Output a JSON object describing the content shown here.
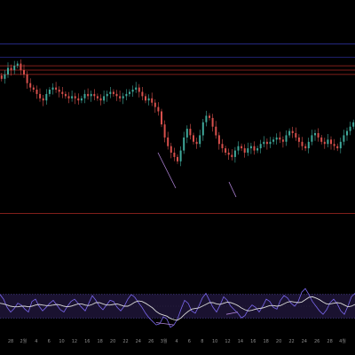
{
  "colors": {
    "background": "#000000",
    "candle_up": "#3fa89a",
    "candle_down": "#d8504c",
    "upper_level": "#3a3fc8",
    "lower_level": "#c8302a",
    "rsi_line": "#7b68ee",
    "rsi_signal": "#d9d9d9",
    "rsi_band_fill": "#1a1230",
    "rsi_band_border": "#6a5acd",
    "axis_text": "#8c8c8c",
    "divergence": "#b084d8"
  },
  "chart_data": [
    {
      "type": "candlestick",
      "title": "",
      "xlabel": "",
      "ylabel": "",
      "x_tick_labels": [
        "28",
        "2월",
        "4",
        "6",
        "10",
        "12",
        "16",
        "18",
        "20",
        "22",
        "24",
        "26",
        "3월",
        "4",
        "6",
        "8",
        "10",
        "12",
        "14",
        "16",
        "18",
        "20",
        "22",
        "24",
        "26",
        "28",
        "4월"
      ],
      "horizontal_levels": [
        {
          "name": "level-1",
          "value": 100,
          "color": "#3a3fc8"
        },
        {
          "name": "level-2",
          "value": 94,
          "color": "#3a3fc8"
        },
        {
          "name": "level-3",
          "value": 90,
          "color": "#c8302a"
        },
        {
          "name": "level-4",
          "value": 88,
          "color": "#c8302a"
        },
        {
          "name": "level-5",
          "value": 86,
          "color": "#c8302a"
        },
        {
          "name": "level-6",
          "value": 22,
          "color": "#c8302a"
        }
      ],
      "ylim": [
        10,
        108
      ],
      "close_series": [
        84,
        86,
        89,
        88,
        90,
        91,
        88,
        86,
        82,
        80,
        79,
        77,
        75,
        74,
        77,
        79,
        80,
        79,
        78,
        77,
        76,
        75,
        76,
        75,
        74,
        75,
        77,
        76,
        77,
        76,
        75,
        74,
        76,
        77,
        78,
        77,
        76,
        75,
        76,
        77,
        78,
        79,
        80,
        78,
        76,
        74,
        75,
        73,
        71,
        69,
        63,
        57,
        53,
        50,
        48,
        46,
        51,
        57,
        61,
        58,
        55,
        54,
        58,
        64,
        67,
        66,
        62,
        58,
        54,
        52,
        50,
        49,
        48,
        51,
        53,
        52,
        50,
        52,
        53,
        51,
        52,
        54,
        55,
        54,
        55,
        56,
        57,
        56,
        55,
        58,
        60,
        59,
        57,
        55,
        53,
        52,
        55,
        58,
        59,
        57,
        55,
        54,
        56,
        54,
        53,
        52,
        55,
        58,
        60,
        62,
        64
      ],
      "grid": false,
      "legend": "none"
    },
    {
      "type": "line",
      "title": "",
      "ylim": [
        0,
        100
      ],
      "band": [
        30,
        70
      ],
      "series": [
        {
          "values": [
            70,
            62,
            48,
            40,
            46,
            55,
            52,
            45,
            40,
            58,
            62,
            50,
            42,
            48,
            55,
            60,
            52,
            44,
            40,
            50,
            58,
            62,
            55,
            48,
            42,
            55,
            68,
            60,
            50,
            44,
            52,
            60,
            58,
            48,
            42,
            50,
            62,
            70,
            65,
            56,
            48,
            38,
            30,
            24,
            18,
            20,
            32,
            28,
            14,
            18,
            28,
            45,
            60,
            55,
            42,
            38,
            50,
            64,
            72,
            60,
            48,
            40,
            52,
            66,
            60,
            50,
            44,
            38,
            30,
            34,
            45,
            52,
            48,
            40,
            50,
            62,
            58,
            48,
            45,
            60,
            68,
            64,
            55,
            50,
            58,
            74,
            80,
            70,
            58,
            50,
            42,
            36,
            44,
            56,
            62,
            54,
            42,
            36,
            50,
            66,
            72
          ]
        },
        {
          "values": [
            55,
            54,
            52,
            50,
            49,
            49,
            50,
            50,
            49,
            50,
            52,
            53,
            52,
            51,
            51,
            52,
            53,
            52,
            50,
            49,
            50,
            52,
            54,
            54,
            52,
            51,
            53,
            56,
            56,
            54,
            52,
            52,
            53,
            54,
            52,
            50,
            50,
            53,
            57,
            59,
            58,
            55,
            51,
            47,
            41,
            37,
            35,
            33,
            29,
            27,
            26,
            30,
            36,
            41,
            45,
            46,
            47,
            50,
            53,
            56,
            56,
            54,
            53,
            55,
            57,
            56,
            54,
            51,
            47,
            44,
            42,
            43,
            45,
            46,
            47,
            49,
            51,
            51,
            50,
            51,
            54,
            57,
            58,
            57,
            56,
            57,
            61,
            65,
            66,
            64,
            61,
            57,
            54,
            54,
            55,
            56,
            55,
            52,
            49,
            50,
            53
          ]
        }
      ]
    }
  ]
}
